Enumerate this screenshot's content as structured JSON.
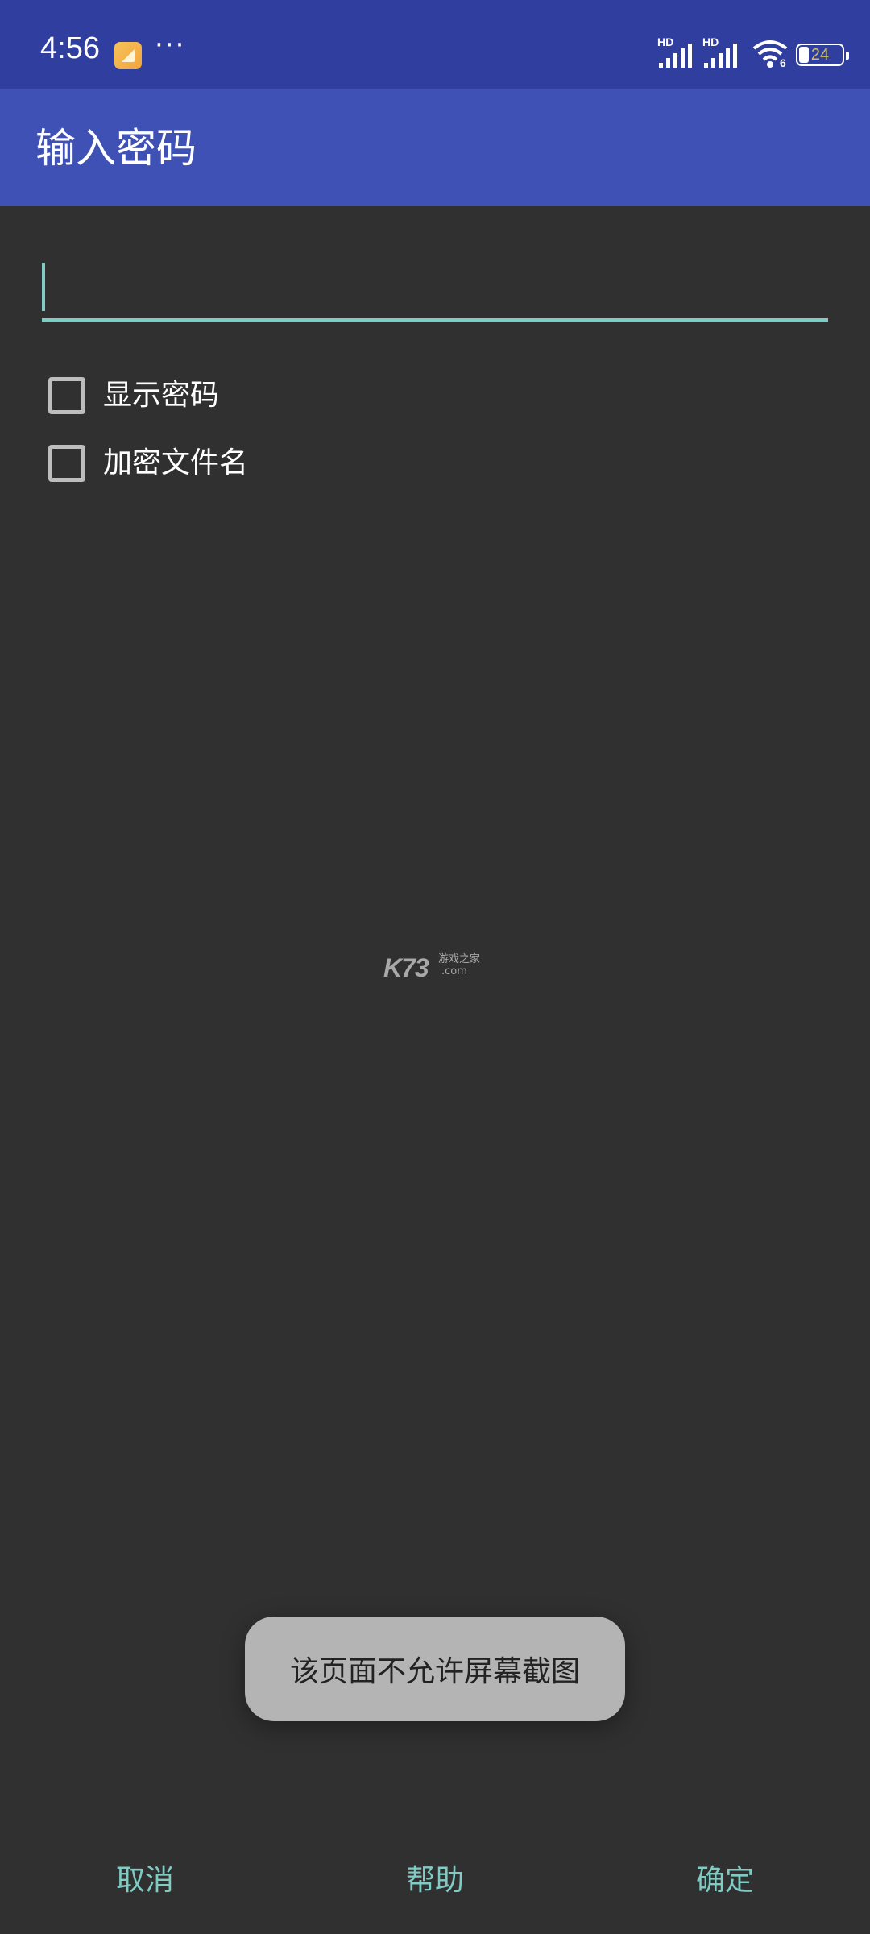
{
  "status_bar": {
    "time": "4:56",
    "more_indicator": "···",
    "signal_1_label": "HD",
    "signal_2_label": "HD",
    "wifi_badge": "6",
    "battery_percent": "24",
    "battery_level": 0.24,
    "icons": [
      "notification-app-icon",
      "signal-icon",
      "signal-icon",
      "wifi-icon",
      "battery-icon"
    ]
  },
  "app_bar": {
    "title": "输入密码",
    "color": "#3f51b5"
  },
  "password": {
    "value": "",
    "placeholder": ""
  },
  "options": {
    "show_password_label": "显示密码",
    "show_password_checked": false,
    "encrypt_filename_label": "加密文件名",
    "encrypt_filename_checked": false
  },
  "watermark": {
    "main": "K73",
    "sub1": "游戏之家",
    "sub2": ".com"
  },
  "toast": {
    "message": "该页面不允许屏幕截图"
  },
  "buttons": {
    "cancel": "取消",
    "help": "帮助",
    "ok": "确定"
  },
  "colors": {
    "status_bar": "#303f9f",
    "accent": "#80cbc4",
    "background": "#303030"
  }
}
